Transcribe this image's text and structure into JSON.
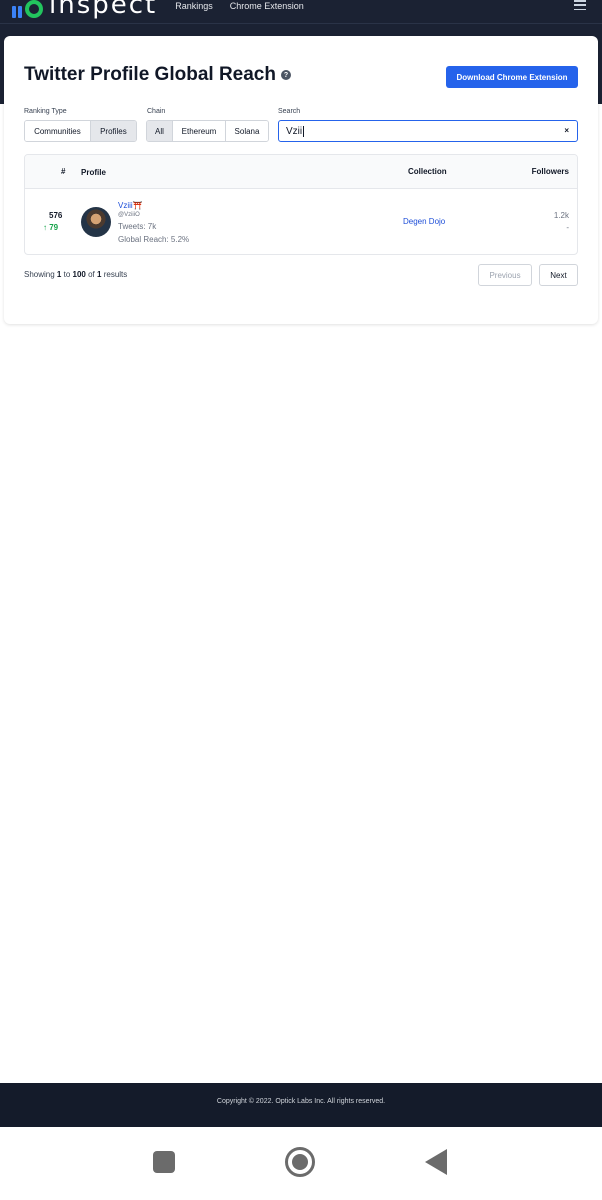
{
  "nav": {
    "logo_text": "inspect",
    "links": [
      "Rankings",
      "Chrome Extension"
    ]
  },
  "page": {
    "title": "Twitter Profile Global Reach",
    "download_label": "Download Chrome Extension"
  },
  "filters": {
    "ranking_type_label": "Ranking Type",
    "ranking_type_options": [
      "Communities",
      "Profiles"
    ],
    "ranking_type_selected": "Profiles",
    "chain_label": "Chain",
    "chain_options": [
      "All",
      "Ethereum",
      "Solana"
    ],
    "chain_selected": "All",
    "search_label": "Search",
    "search_value": "Vzii",
    "clear_symbol": "×"
  },
  "table": {
    "headers": {
      "rank": "#",
      "profile": "Profile",
      "collection": "Collection",
      "followers": "Followers"
    },
    "rows": [
      {
        "rank": "576",
        "change": "79",
        "name": "Vziii⛩️",
        "handle": "@VziiiO",
        "tweets": "Tweets: 7k",
        "reach": "Global Reach: 5.2%",
        "collection": "Degen Dojo",
        "followers": "1.2k",
        "followers_change": "-"
      }
    ]
  },
  "pagination": {
    "showing_prefix": "Showing",
    "from": "1",
    "to_word": "to",
    "to": "100",
    "of_word": "of",
    "total": "1",
    "results_word": "results",
    "previous": "Previous",
    "next": "Next"
  },
  "footer": {
    "copyright": "Copyright © 2022. Optick Labs Inc. All rights reserved."
  },
  "colors": {
    "nav_bg": "#1b2233",
    "primary": "#2563eb",
    "positive": "#16a34a"
  }
}
